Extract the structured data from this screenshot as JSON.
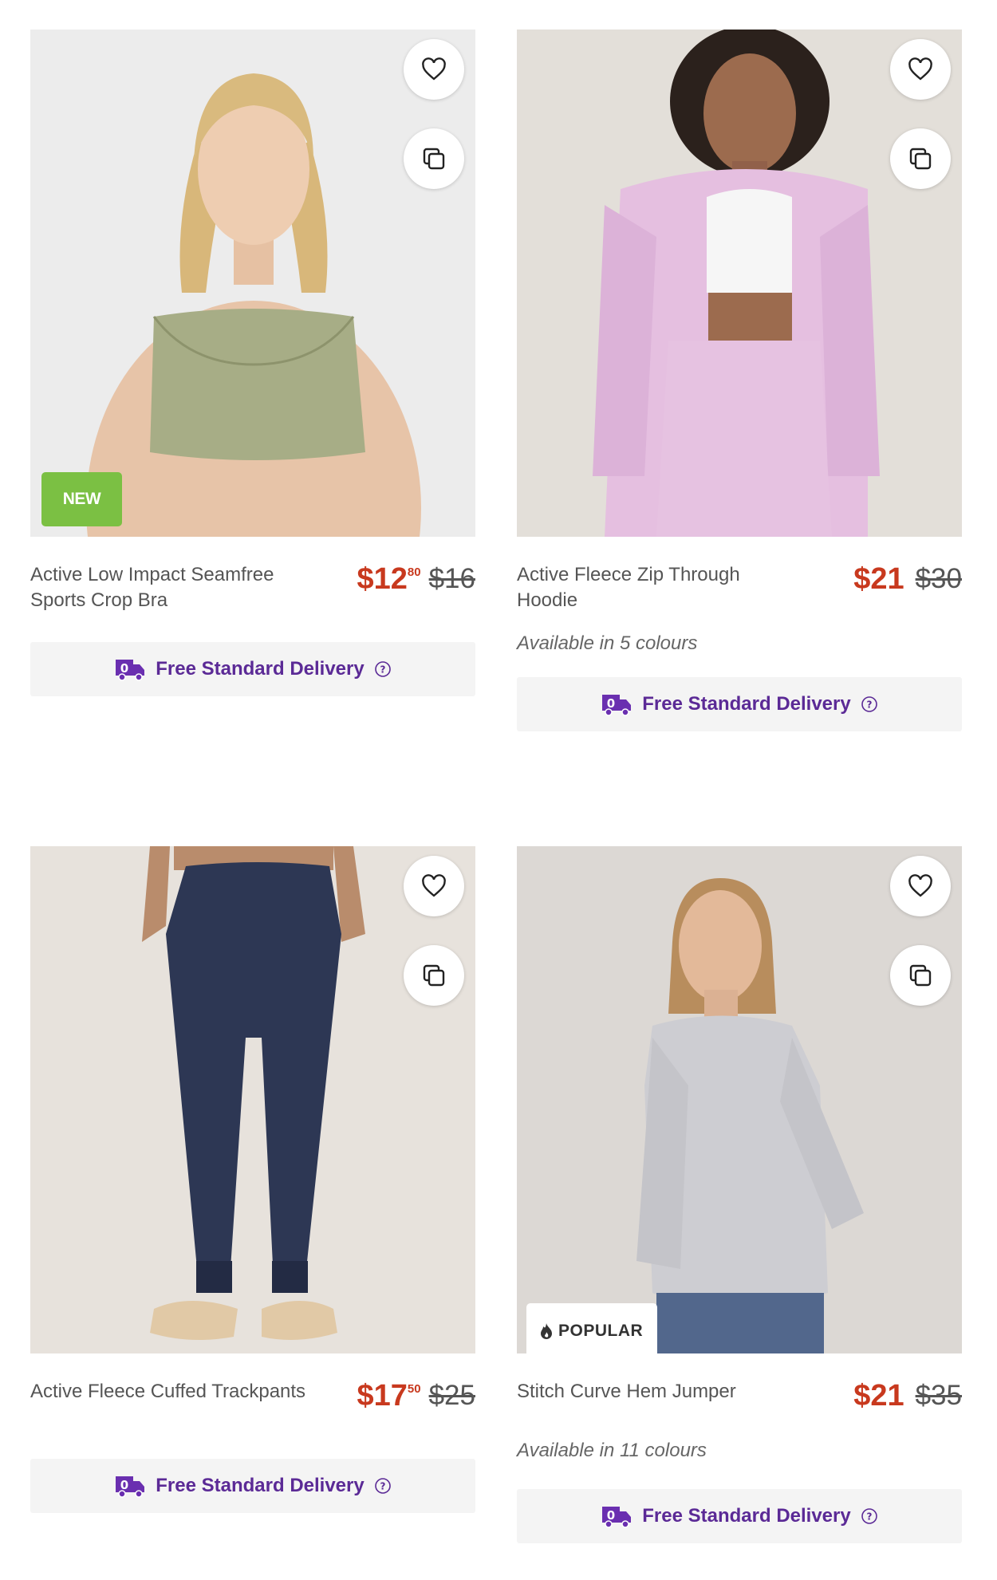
{
  "products": [
    {
      "name": "Active Low Impact Seamfree Sports Crop Bra",
      "price_main": "$12",
      "price_cents": "80",
      "was_price": "$16",
      "badge": "NEW",
      "colours": "",
      "delivery": "Free Standard Delivery"
    },
    {
      "name": "Active Fleece Zip Through Hoodie",
      "price_main": "$21",
      "price_cents": "",
      "was_price": "$30",
      "badge": "",
      "colours": "Available in 5 colours",
      "delivery": "Free Standard Delivery"
    },
    {
      "name": "Active Fleece Cuffed Trackpants",
      "price_main": "$17",
      "price_cents": "50",
      "was_price": "$25",
      "badge": "",
      "colours": "",
      "delivery": "Free Standard Delivery"
    },
    {
      "name": "Stitch Curve Hem Jumper",
      "price_main": "$21",
      "price_cents": "",
      "was_price": "$35",
      "badge": "POPULAR",
      "colours": "Available in 11 colours",
      "delivery": "Free Standard Delivery"
    }
  ],
  "icons": {
    "wishlist": "heart-icon",
    "compare": "compare-icon",
    "delivery": "delivery-truck-icon",
    "help": "help-circle-icon",
    "popular": "flame-icon"
  },
  "colors": {
    "sale_price": "#c8391e",
    "delivery_text": "#5b2a96",
    "new_badge": "#7bc043"
  }
}
